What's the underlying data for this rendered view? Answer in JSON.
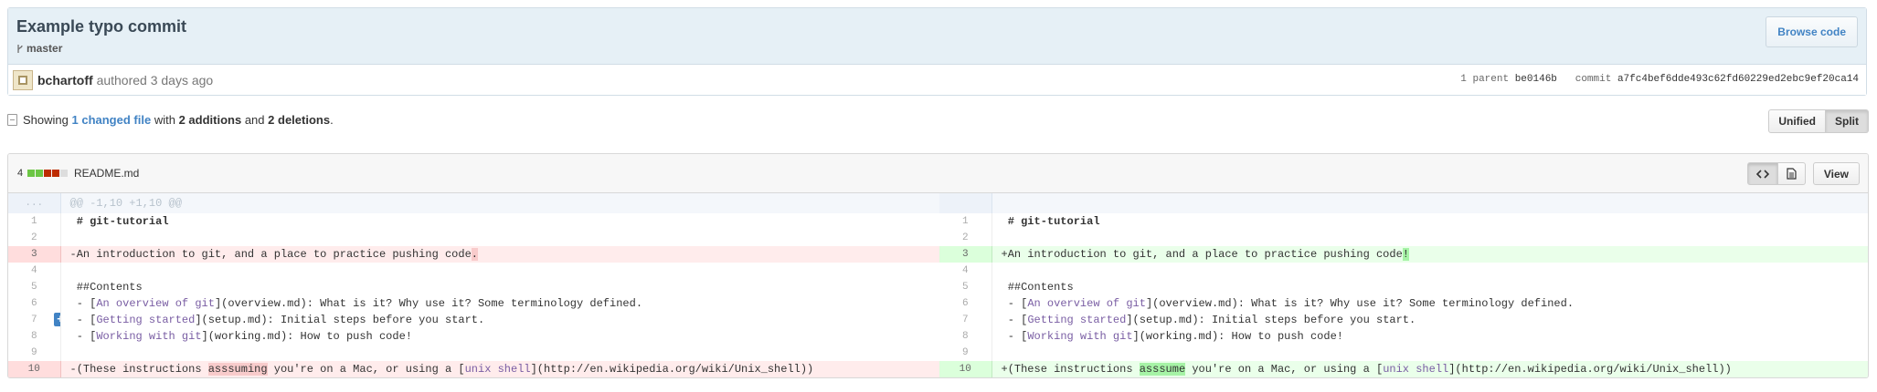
{
  "commit": {
    "title": "Example typo commit",
    "branch": "master",
    "browse_label": "Browse code",
    "author": "bchartoff",
    "authored": "authored 3 days ago",
    "parent_label": "1 parent",
    "parent_sha": "be0146b",
    "commit_label": "commit",
    "commit_sha": "a7fc4bef6dde493c62fd60229ed2ebc9ef20ca14"
  },
  "toc": {
    "prefix": "Showing",
    "changed": "1 changed file",
    "with": "with",
    "additions": "2 additions",
    "and": "and",
    "deletions": "2 deletions",
    "period": "."
  },
  "view_toggle": {
    "unified": "Unified",
    "split": "Split"
  },
  "file": {
    "change_count": "4",
    "name": "README.md",
    "view_label": "View",
    "stat_blocks": [
      "add",
      "add",
      "del",
      "del",
      "neutral"
    ]
  },
  "diff": {
    "hunk_marker": "...",
    "hunk_header": "@@ -1,10 +1,10 @@",
    "left": {
      "l1": {
        "num": "1",
        "text": " # git-tutorial"
      },
      "l2": {
        "num": "2"
      },
      "l3": {
        "num": "3",
        "pre": "-An introduction to git, and a place to practice pushing code",
        "changed": "."
      },
      "l4": {
        "num": "4"
      },
      "l5": {
        "num": "5",
        "text": " ##Contents"
      },
      "l6": {
        "num": "6",
        "pre": " - [",
        "link": "An overview of git",
        "post": "](overview.md): What is it? Why use it? Some terminology defined."
      },
      "l7": {
        "num": "7",
        "pre": " - [",
        "link": "Getting started",
        "post": "](setup.md): Initial steps before you start."
      },
      "l8": {
        "num": "8",
        "pre": " - [",
        "link": "Working with git",
        "post": "](working.md): How to push code!"
      },
      "l9": {
        "num": "9"
      },
      "l10": {
        "num": "10",
        "pre": "-(These instructions ",
        "changed": "asssuming",
        "mid": " you're on a Mac, or using a [",
        "link": "unix shell",
        "post": "](http://en.wikipedia.org/wiki/Unix_shell))"
      }
    },
    "right": {
      "l1": {
        "num": "1",
        "text": " # git-tutorial"
      },
      "l2": {
        "num": "2"
      },
      "l3": {
        "num": "3",
        "pre": "+An introduction to git, and a place to practice pushing code",
        "changed": "!"
      },
      "l4": {
        "num": "4"
      },
      "l5": {
        "num": "5",
        "text": " ##Contents"
      },
      "l6": {
        "num": "6",
        "pre": " - [",
        "link": "An overview of git",
        "post": "](overview.md): What is it? Why use it? Some terminology defined."
      },
      "l7": {
        "num": "7",
        "pre": " - [",
        "link": "Getting started",
        "post": "](setup.md): Initial steps before you start."
      },
      "l8": {
        "num": "8",
        "pre": " - [",
        "link": "Working with git",
        "post": "](working.md): How to push code!"
      },
      "l9": {
        "num": "9"
      },
      "l10": {
        "num": "10",
        "pre": "+(These instructions ",
        "changed": "asssume",
        "mid": " you're on a Mac, or using a [",
        "link": "unix shell",
        "post": "](http://en.wikipedia.org/wiki/Unix_shell))"
      }
    }
  },
  "colors": {
    "link": "#4183c4",
    "add_bg": "#eaffea",
    "del_bg": "#ffecec",
    "add_highlight": "#a6f3a6",
    "del_highlight": "#f8cbcb"
  },
  "icons": [
    "branch-icon",
    "toc-icon",
    "code-icon",
    "file-icon",
    "add-comment-icon"
  ]
}
